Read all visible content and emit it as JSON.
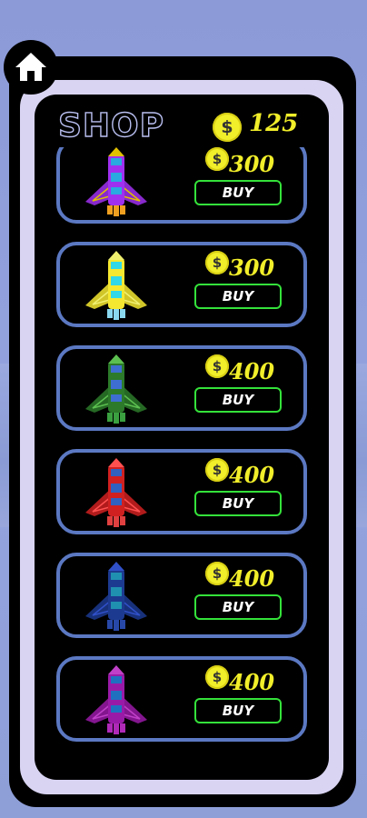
{
  "header": {
    "title": "SHOP",
    "coin_symbol": "$",
    "balance": "125"
  },
  "home_icon": "home-icon",
  "colors": {
    "accent": "#f1ee2a",
    "buy_border": "#34e23a",
    "card_border": "#5b78c2",
    "frame": "#d9d4f2"
  },
  "items": [
    {
      "price": "300",
      "buy_label": "BUY",
      "coin_symbol": "$",
      "ship": {
        "main": "#a030f0",
        "window": "#2aa8e0",
        "flame": "#f0a020",
        "trim": "#e0c000"
      }
    },
    {
      "price": "300",
      "buy_label": "BUY",
      "coin_symbol": "$",
      "ship": {
        "main": "#f5e830",
        "window": "#30d8e8",
        "flame": "#8ad8f0",
        "trim": "#f0f070"
      }
    },
    {
      "price": "400",
      "buy_label": "BUY",
      "coin_symbol": "$",
      "ship": {
        "main": "#2c7a2a",
        "window": "#3e6ed0",
        "flame": "#3aa040",
        "trim": "#5cc050"
      }
    },
    {
      "price": "400",
      "buy_label": "BUY",
      "coin_symbol": "$",
      "ship": {
        "main": "#d02020",
        "window": "#3060c0",
        "flame": "#e04040",
        "trim": "#ff5050"
      }
    },
    {
      "price": "400",
      "buy_label": "BUY",
      "coin_symbol": "$",
      "ship": {
        "main": "#1c3a90",
        "window": "#2090b0",
        "flame": "#2848a8",
        "trim": "#3050c8"
      }
    },
    {
      "price": "400",
      "buy_label": "BUY",
      "coin_symbol": "$",
      "ship": {
        "main": "#9a1aa8",
        "window": "#2070c0",
        "flame": "#b02ab8",
        "trim": "#c040c8"
      }
    }
  ]
}
